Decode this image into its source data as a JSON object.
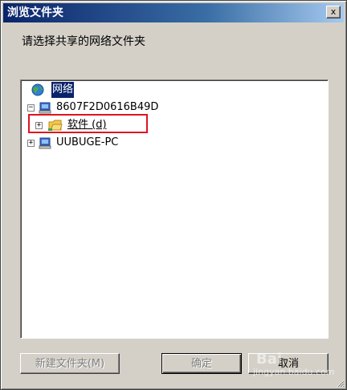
{
  "window": {
    "title": "浏览文件夹",
    "close_glyph": "x",
    "prompt": "请选择共享的网络文件夹"
  },
  "tree": {
    "root": {
      "label": "网络",
      "icon": "network-globe-icon"
    },
    "computers": [
      {
        "label": "8607F2D0616B49D",
        "expander": "−",
        "expanded": true,
        "icon": "computer-icon"
      },
      {
        "label": "UUBUGE-PC",
        "expander": "+",
        "expanded": false,
        "icon": "computer-icon"
      }
    ],
    "shared_folder": {
      "label": "软件 (d)",
      "expander": "+",
      "icon": "folder-icon"
    }
  },
  "buttons": {
    "new_folder": "新建文件夹(M)",
    "ok": "确定",
    "cancel": "取消"
  },
  "watermark": {
    "logo": "Bai",
    "text": "jingyan.baidu.com"
  },
  "colors": {
    "title_bar_start": "#0a246a",
    "title_bar_end": "#a6caf0",
    "selection": "#0a246a",
    "highlight_box": "#e0131f",
    "dialog_face": "#d4d0c8"
  }
}
